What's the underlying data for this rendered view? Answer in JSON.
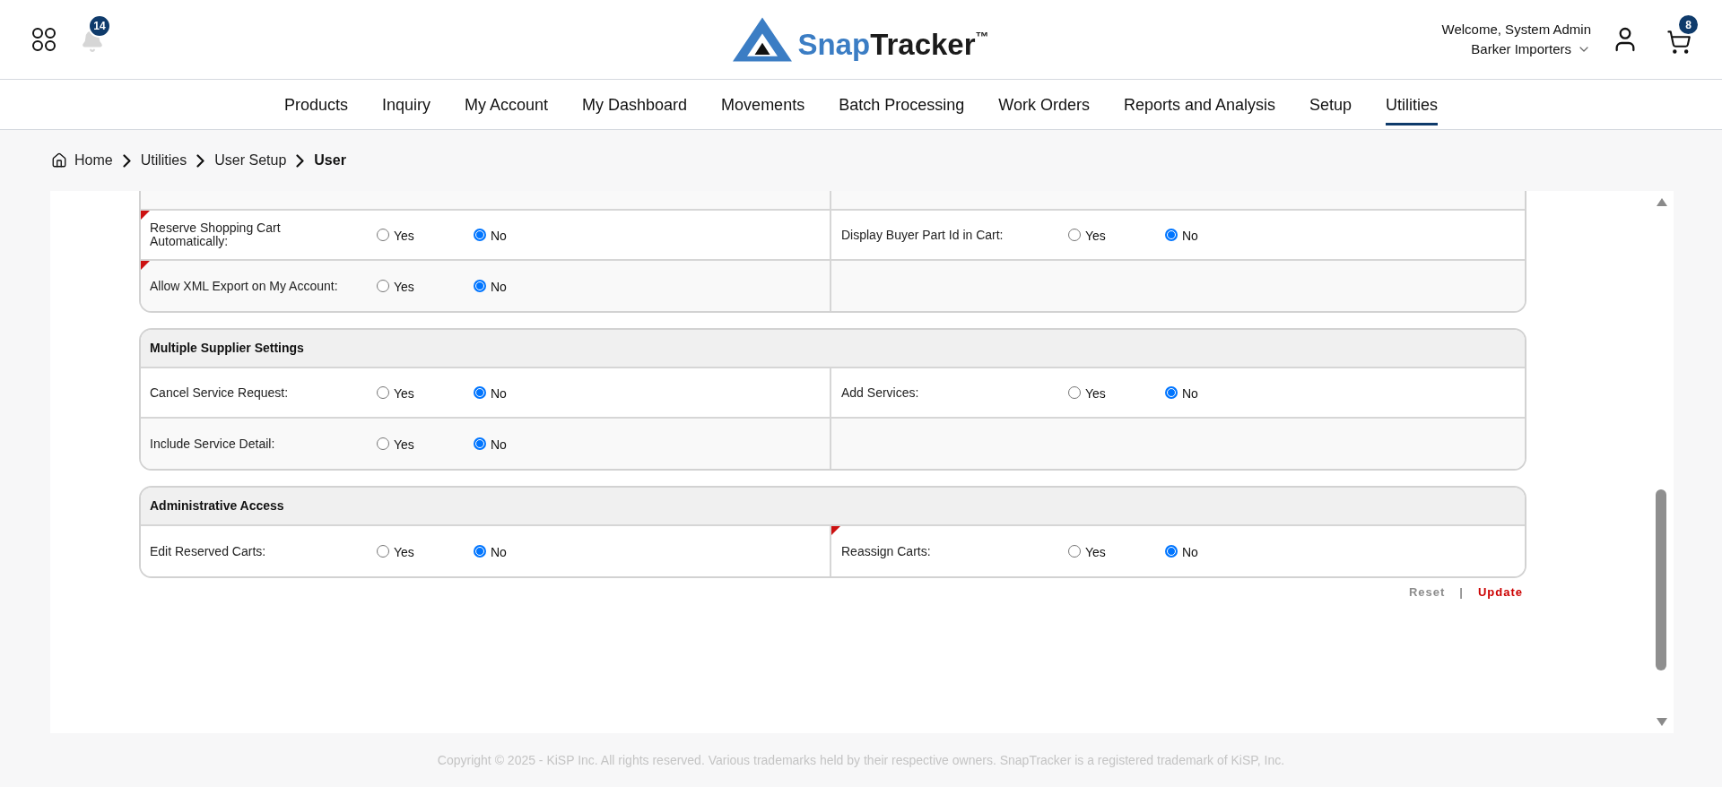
{
  "header": {
    "notifications_badge": "14",
    "logo": {
      "part_1": "Snap",
      "part_2": "Tracker",
      "mark": "™"
    },
    "welcome": "Welcome, System Admin",
    "company": "Barker Importers",
    "cart_badge": "8"
  },
  "nav": [
    {
      "label": "Products",
      "selected": false
    },
    {
      "label": "Inquiry",
      "selected": false
    },
    {
      "label": "My Account",
      "selected": false
    },
    {
      "label": "My Dashboard",
      "selected": false
    },
    {
      "label": "Movements",
      "selected": false
    },
    {
      "label": "Batch Processing",
      "selected": false
    },
    {
      "label": "Work Orders",
      "selected": false
    },
    {
      "label": "Reports and Analysis",
      "selected": false
    },
    {
      "label": "Setup",
      "selected": false
    },
    {
      "label": "Utilities",
      "selected": true
    }
  ],
  "breadcrumb": [
    {
      "label": "Home",
      "current": false
    },
    {
      "label": "Utilities",
      "current": false
    },
    {
      "label": "User Setup",
      "current": false
    },
    {
      "label": "User",
      "current": true
    }
  ],
  "sections": [
    {
      "clipped_top": true,
      "rows": [
        {
          "cells": [
            {
              "label": "Reserve Shopping Cart Automatically:",
              "flagged": true,
              "options": [
                {
                  "label": "Yes",
                  "selected": false
                },
                {
                  "label": "No",
                  "selected": true
                }
              ]
            },
            {
              "label": "Display Buyer Part Id in Cart:",
              "flagged": false,
              "options": [
                {
                  "label": "Yes",
                  "selected": false
                },
                {
                  "label": "No",
                  "selected": true
                }
              ]
            }
          ]
        },
        {
          "cells": [
            {
              "label": "Allow XML Export on My Account:",
              "flagged": true,
              "options": [
                {
                  "label": "Yes",
                  "selected": false
                },
                {
                  "label": "No",
                  "selected": true
                }
              ]
            }
          ]
        }
      ]
    },
    {
      "title": "Multiple Supplier Settings",
      "rows": [
        {
          "cells": [
            {
              "label": "Cancel Service Request:",
              "flagged": false,
              "options": [
                {
                  "label": "Yes",
                  "selected": false
                },
                {
                  "label": "No",
                  "selected": true
                }
              ]
            },
            {
              "label": "Add Services:",
              "flagged": false,
              "options": [
                {
                  "label": "Yes",
                  "selected": false
                },
                {
                  "label": "No",
                  "selected": true
                }
              ]
            }
          ]
        },
        {
          "cells": [
            {
              "label": "Include Service Detail:",
              "flagged": false,
              "options": [
                {
                  "label": "Yes",
                  "selected": false
                },
                {
                  "label": "No",
                  "selected": true
                }
              ]
            }
          ]
        }
      ]
    },
    {
      "title": "Administrative Access",
      "rows": [
        {
          "cells": [
            {
              "label": "Edit Reserved Carts:",
              "flagged": false,
              "options": [
                {
                  "label": "Yes",
                  "selected": false
                },
                {
                  "label": "No",
                  "selected": true
                }
              ]
            },
            {
              "label": "Reassign Carts:",
              "flagged": true,
              "options": [
                {
                  "label": "Yes",
                  "selected": false
                },
                {
                  "label": "No",
                  "selected": true
                }
              ]
            }
          ]
        }
      ]
    }
  ],
  "actions": {
    "items": [
      {
        "label": "Reset",
        "kind": "secondary"
      },
      {
        "label": "Update",
        "kind": "primary"
      }
    ],
    "separator": "|"
  },
  "footer": {
    "copyright": "Copyright © 2025 - KiSP Inc. All rights reserved. Various trademarks held by their respective owners. SnapTracker is a registered trademark of KiSP, Inc."
  }
}
